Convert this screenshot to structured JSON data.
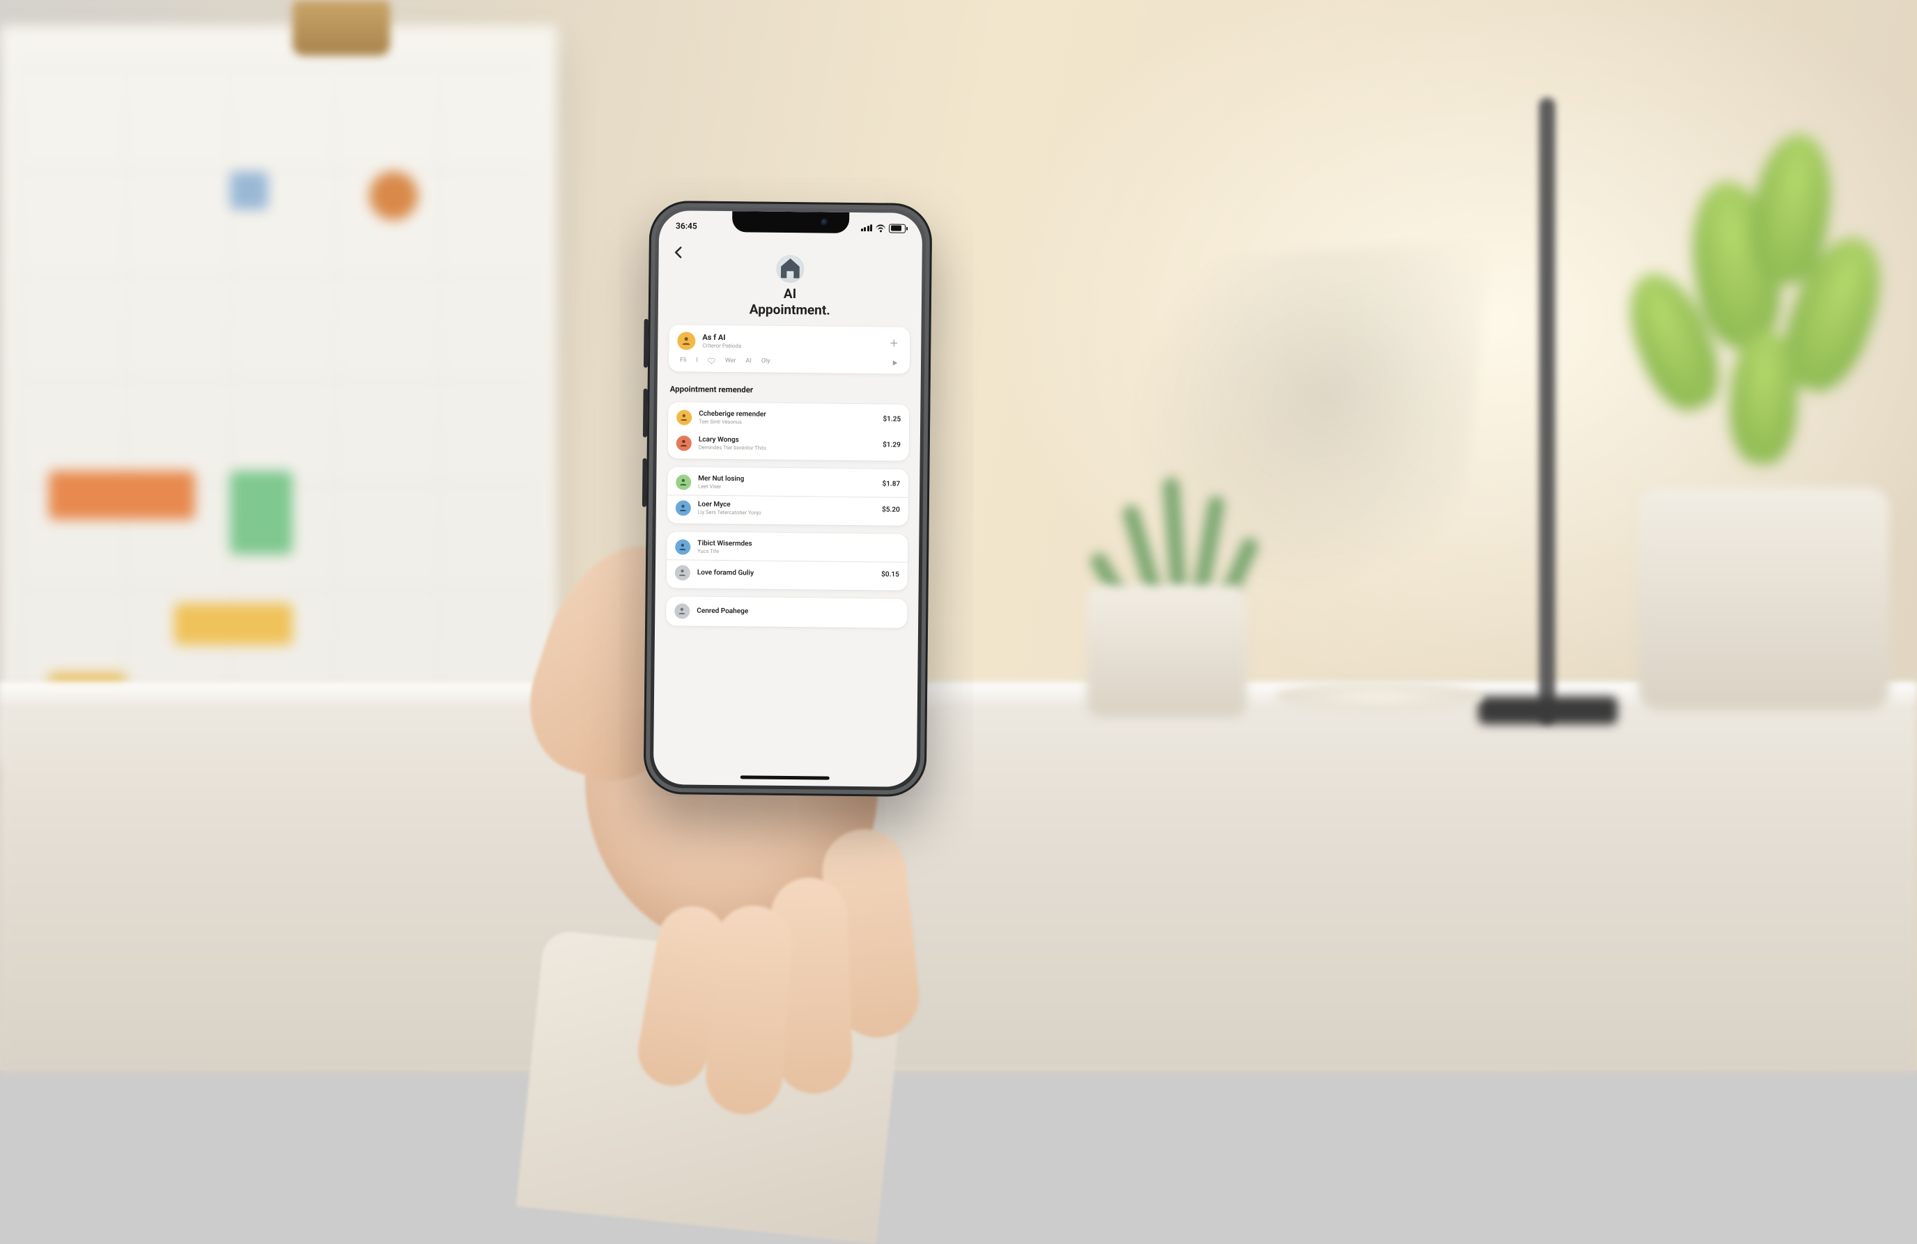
{
  "statusbar": {
    "time": "36:45"
  },
  "header": {
    "title_line1": "AI",
    "title_line2": "Appointment."
  },
  "profile": {
    "name": "As f AI",
    "subtitle": "Criteror Patioda",
    "chips": [
      "Fli",
      "I",
      "Wer",
      "AI",
      "Oly"
    ]
  },
  "section1": {
    "heading": "Appointment remender",
    "items": [
      {
        "title": "Ccheberige remender",
        "subtitle": "Tser Sinti Vesonus",
        "amount": "$1.25",
        "avatar": "a"
      },
      {
        "title": "Lcary Wongs",
        "subtitle": "Demindes Tter borentor Thits",
        "amount": "$1.29",
        "avatar": "b"
      }
    ]
  },
  "section2": {
    "items": [
      {
        "title": "Mer Nut losing",
        "subtitle": "Leet Viser",
        "amount": "$1.87",
        "avatar": "c"
      },
      {
        "title": "Loer Myce",
        "subtitle": "Liy Sers Tetercatotier Yonjo",
        "amount": "$5.20",
        "avatar": "d"
      }
    ]
  },
  "section3": {
    "items": [
      {
        "title": "Tibict Wisermdes",
        "subtitle": "Yucs Tife",
        "amount": "",
        "avatar": "d"
      },
      {
        "title": "Love foramd Guliy",
        "subtitle": "",
        "amount": "$0.15",
        "avatar": "e"
      }
    ]
  },
  "footer": {
    "items": [
      {
        "title": "Cenred Poahege",
        "avatar": "e"
      }
    ]
  }
}
